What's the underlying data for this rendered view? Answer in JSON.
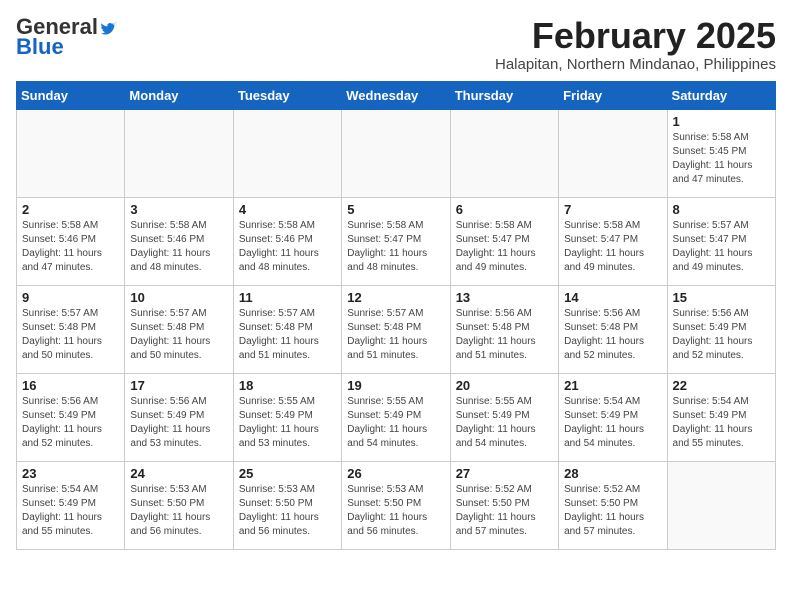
{
  "header": {
    "logo_general": "General",
    "logo_blue": "Blue",
    "month_year": "February 2025",
    "location": "Halapitan, Northern Mindanao, Philippines"
  },
  "weekdays": [
    "Sunday",
    "Monday",
    "Tuesday",
    "Wednesday",
    "Thursday",
    "Friday",
    "Saturday"
  ],
  "weeks": [
    [
      {
        "day": "",
        "info": ""
      },
      {
        "day": "",
        "info": ""
      },
      {
        "day": "",
        "info": ""
      },
      {
        "day": "",
        "info": ""
      },
      {
        "day": "",
        "info": ""
      },
      {
        "day": "",
        "info": ""
      },
      {
        "day": "1",
        "info": "Sunrise: 5:58 AM\nSunset: 5:45 PM\nDaylight: 11 hours\nand 47 minutes."
      }
    ],
    [
      {
        "day": "2",
        "info": "Sunrise: 5:58 AM\nSunset: 5:46 PM\nDaylight: 11 hours\nand 47 minutes."
      },
      {
        "day": "3",
        "info": "Sunrise: 5:58 AM\nSunset: 5:46 PM\nDaylight: 11 hours\nand 48 minutes."
      },
      {
        "day": "4",
        "info": "Sunrise: 5:58 AM\nSunset: 5:46 PM\nDaylight: 11 hours\nand 48 minutes."
      },
      {
        "day": "5",
        "info": "Sunrise: 5:58 AM\nSunset: 5:47 PM\nDaylight: 11 hours\nand 48 minutes."
      },
      {
        "day": "6",
        "info": "Sunrise: 5:58 AM\nSunset: 5:47 PM\nDaylight: 11 hours\nand 49 minutes."
      },
      {
        "day": "7",
        "info": "Sunrise: 5:58 AM\nSunset: 5:47 PM\nDaylight: 11 hours\nand 49 minutes."
      },
      {
        "day": "8",
        "info": "Sunrise: 5:57 AM\nSunset: 5:47 PM\nDaylight: 11 hours\nand 49 minutes."
      }
    ],
    [
      {
        "day": "9",
        "info": "Sunrise: 5:57 AM\nSunset: 5:48 PM\nDaylight: 11 hours\nand 50 minutes."
      },
      {
        "day": "10",
        "info": "Sunrise: 5:57 AM\nSunset: 5:48 PM\nDaylight: 11 hours\nand 50 minutes."
      },
      {
        "day": "11",
        "info": "Sunrise: 5:57 AM\nSunset: 5:48 PM\nDaylight: 11 hours\nand 51 minutes."
      },
      {
        "day": "12",
        "info": "Sunrise: 5:57 AM\nSunset: 5:48 PM\nDaylight: 11 hours\nand 51 minutes."
      },
      {
        "day": "13",
        "info": "Sunrise: 5:56 AM\nSunset: 5:48 PM\nDaylight: 11 hours\nand 51 minutes."
      },
      {
        "day": "14",
        "info": "Sunrise: 5:56 AM\nSunset: 5:48 PM\nDaylight: 11 hours\nand 52 minutes."
      },
      {
        "day": "15",
        "info": "Sunrise: 5:56 AM\nSunset: 5:49 PM\nDaylight: 11 hours\nand 52 minutes."
      }
    ],
    [
      {
        "day": "16",
        "info": "Sunrise: 5:56 AM\nSunset: 5:49 PM\nDaylight: 11 hours\nand 52 minutes."
      },
      {
        "day": "17",
        "info": "Sunrise: 5:56 AM\nSunset: 5:49 PM\nDaylight: 11 hours\nand 53 minutes."
      },
      {
        "day": "18",
        "info": "Sunrise: 5:55 AM\nSunset: 5:49 PM\nDaylight: 11 hours\nand 53 minutes."
      },
      {
        "day": "19",
        "info": "Sunrise: 5:55 AM\nSunset: 5:49 PM\nDaylight: 11 hours\nand 54 minutes."
      },
      {
        "day": "20",
        "info": "Sunrise: 5:55 AM\nSunset: 5:49 PM\nDaylight: 11 hours\nand 54 minutes."
      },
      {
        "day": "21",
        "info": "Sunrise: 5:54 AM\nSunset: 5:49 PM\nDaylight: 11 hours\nand 54 minutes."
      },
      {
        "day": "22",
        "info": "Sunrise: 5:54 AM\nSunset: 5:49 PM\nDaylight: 11 hours\nand 55 minutes."
      }
    ],
    [
      {
        "day": "23",
        "info": "Sunrise: 5:54 AM\nSunset: 5:49 PM\nDaylight: 11 hours\nand 55 minutes."
      },
      {
        "day": "24",
        "info": "Sunrise: 5:53 AM\nSunset: 5:50 PM\nDaylight: 11 hours\nand 56 minutes."
      },
      {
        "day": "25",
        "info": "Sunrise: 5:53 AM\nSunset: 5:50 PM\nDaylight: 11 hours\nand 56 minutes."
      },
      {
        "day": "26",
        "info": "Sunrise: 5:53 AM\nSunset: 5:50 PM\nDaylight: 11 hours\nand 56 minutes."
      },
      {
        "day": "27",
        "info": "Sunrise: 5:52 AM\nSunset: 5:50 PM\nDaylight: 11 hours\nand 57 minutes."
      },
      {
        "day": "28",
        "info": "Sunrise: 5:52 AM\nSunset: 5:50 PM\nDaylight: 11 hours\nand 57 minutes."
      },
      {
        "day": "",
        "info": ""
      }
    ]
  ]
}
